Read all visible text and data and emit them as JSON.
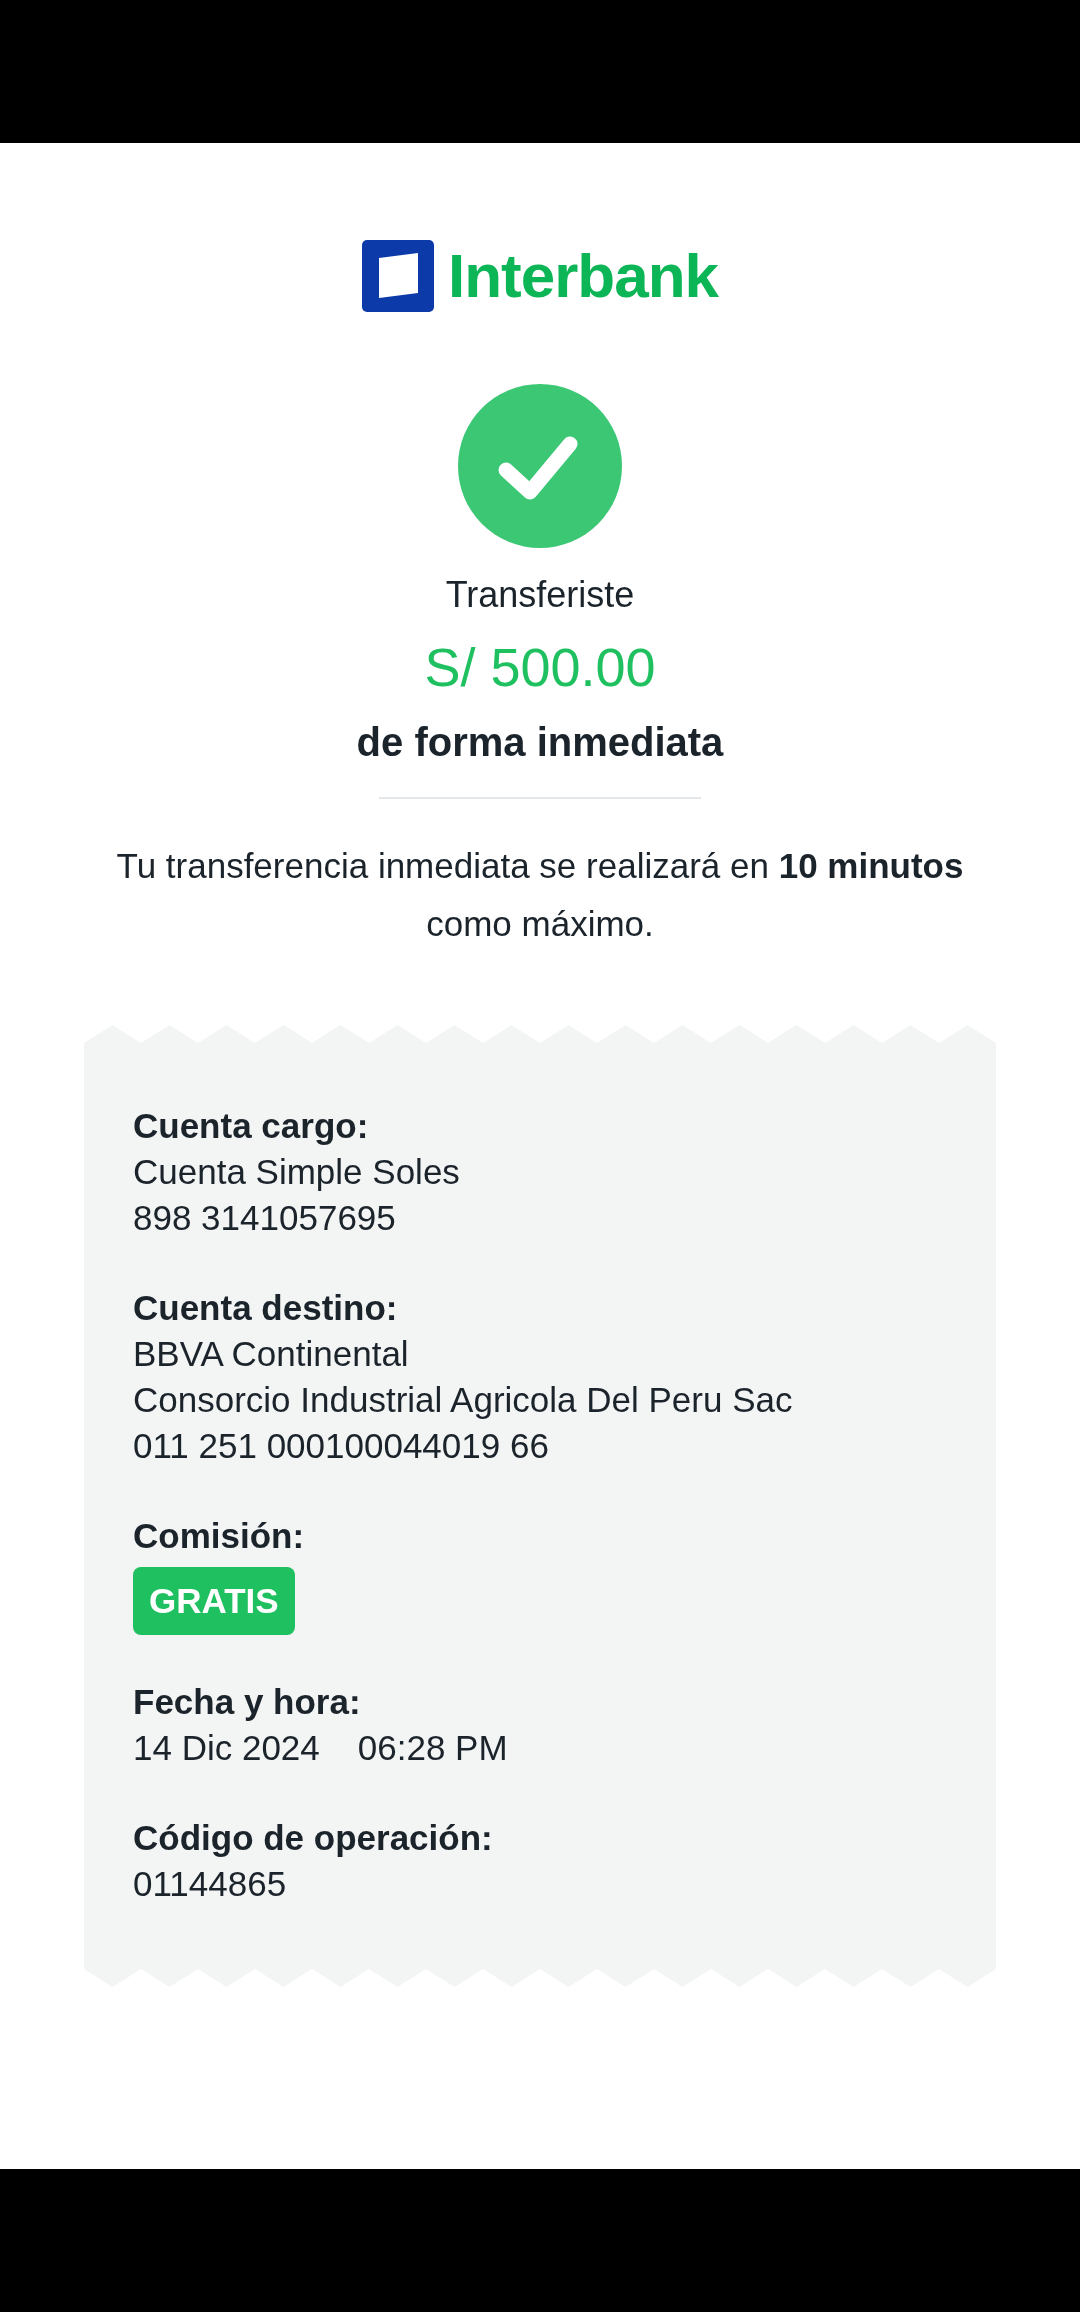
{
  "logo": {
    "text": "Interbank"
  },
  "status": {
    "kind": "success"
  },
  "headline": "Transferiste",
  "amount": "S/ 500.00",
  "mode": "de forma inmediata",
  "notice": "Tu transferencia inmediata se realizará en **10 minutos** como máximo.",
  "details": [
    {
      "label": "Cuenta cargo:",
      "kind": "lines",
      "lines": [
        "Cuenta Simple Soles",
        "898 3141057695"
      ]
    },
    {
      "label": "Cuenta destino:",
      "kind": "lines",
      "lines": [
        "BBVA Continental",
        "Consorcio Industrial Agricola Del Peru Sac",
        "011 251 000100044019 66"
      ]
    },
    {
      "label": "Comisión:",
      "kind": "badge",
      "badge": "GRATIS"
    },
    {
      "label": "Fecha y hora:",
      "kind": "datetime",
      "date": "14 Dic 2024",
      "time": "06:28 PM"
    },
    {
      "label": "Código de operación:",
      "kind": "lines",
      "lines": [
        "01144865"
      ]
    }
  ]
}
